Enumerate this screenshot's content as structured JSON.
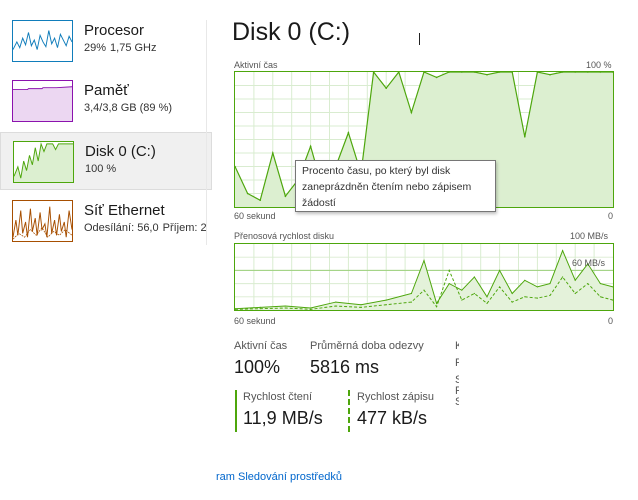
{
  "sidebar": {
    "items": [
      {
        "title": "Procesor",
        "sub": [
          "29%",
          "1,75 GHz"
        ]
      },
      {
        "title": "Paměť",
        "sub": [
          "3,4/3,8 GB (89 %)"
        ]
      },
      {
        "title": "Disk 0 (C:)",
        "sub": [
          "100 %"
        ]
      },
      {
        "title": "Síť Ethernet",
        "sub": [
          "Odesílání: 56,0",
          "Příjem: 2"
        ]
      }
    ]
  },
  "main": {
    "title": "Disk 0 (C:)",
    "active_graph": {
      "label": "Aktivní čas",
      "max": "100 %",
      "time": "60 sekund",
      "min": "0"
    },
    "transfer_graph": {
      "label": "Přenosová rychlost disku",
      "max": "100 MB/s",
      "mid": "60 MB/s",
      "time": "60 sekund",
      "min": "0"
    },
    "tooltip": [
      "Procento času, po který byl disk",
      "zaneprázdněn čtením nebo zápisem",
      "žádostí"
    ],
    "stats": {
      "active_time": {
        "label": "Aktivní čas",
        "value": "100%"
      },
      "avg_response": {
        "label": "Průměrná doba odezvy",
        "value": "5816 ms"
      },
      "read_speed": {
        "label": "Rychlost čtení",
        "value": "11,9 MB/s"
      },
      "write_speed": {
        "label": "Rychlost zápisu",
        "value": "477 kB/s"
      }
    },
    "cut_chars": [
      "K",
      "F",
      "S",
      "F",
      "S"
    ]
  },
  "footer": {
    "link": "ram Sledování prostředků"
  },
  "colors": {
    "disk": "#4da60c",
    "cpu": "#117dbb",
    "memory": "#8b12ae",
    "network": "#a74f01",
    "link": "#0066cc"
  },
  "chart_data": [
    {
      "type": "area",
      "title": "Aktivní čas",
      "ylim": [
        0,
        100
      ],
      "x": [
        60,
        58,
        56,
        54,
        52,
        50,
        48,
        46,
        44,
        42,
        40,
        38,
        36,
        34,
        32,
        30,
        28,
        26,
        24,
        22,
        20,
        18,
        16,
        14,
        12,
        10,
        8,
        6,
        4,
        2,
        0
      ],
      "values": [
        30,
        10,
        5,
        40,
        8,
        20,
        45,
        12,
        30,
        55,
        25,
        100,
        88,
        100,
        70,
        100,
        96,
        100,
        100,
        100,
        98,
        100,
        100,
        52,
        100,
        98,
        100,
        100,
        100,
        100,
        100
      ]
    },
    {
      "type": "line",
      "title": "Přenosová rychlost disku",
      "ylim": [
        0,
        100
      ],
      "x": [
        60,
        56,
        52,
        48,
        44,
        40,
        36,
        32,
        30,
        28,
        26,
        24,
        22,
        20,
        18,
        16,
        14,
        12,
        10,
        8,
        6,
        4,
        2,
        0
      ],
      "series": [
        {
          "values": [
            2,
            4,
            6,
            3,
            12,
            8,
            15,
            25,
            75,
            10,
            40,
            30,
            50,
            20,
            60,
            25,
            45,
            35,
            40,
            90,
            45,
            70,
            40,
            35
          ]
        },
        {
          "values": [
            1,
            2,
            3,
            1,
            6,
            4,
            8,
            12,
            30,
            5,
            60,
            15,
            25,
            10,
            35,
            12,
            20,
            18,
            22,
            50,
            25,
            40,
            20,
            15
          ]
        }
      ]
    }
  ]
}
